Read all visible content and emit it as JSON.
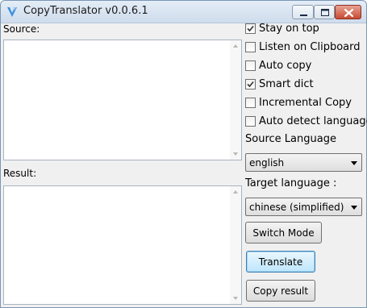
{
  "window": {
    "title": "CopyTranslator v0.0.6.1"
  },
  "titlebar_buttons": {
    "minimize_icon": "minimize-icon",
    "maximize_icon": "maximize-icon",
    "close_icon": "close-icon"
  },
  "source": {
    "label": "Source:",
    "value": ""
  },
  "result": {
    "label": "Result:",
    "value": ""
  },
  "options": [
    {
      "label": "Stay on top",
      "checked": true
    },
    {
      "label": "Listen on Clipboard",
      "checked": false
    },
    {
      "label": "Auto copy",
      "checked": false
    },
    {
      "label": "Smart dict",
      "checked": true
    },
    {
      "label": "Incremental Copy",
      "checked": false
    },
    {
      "label": "Auto detect language",
      "checked": false
    }
  ],
  "source_language": {
    "label": "Source Language",
    "selected": "english"
  },
  "target_language": {
    "label": "Target language :",
    "selected": "chinese (simplified)"
  },
  "buttons": {
    "switch_mode": "Switch Mode",
    "translate": "Translate",
    "copy_result": "Copy result"
  },
  "colors": {
    "accent": "#3c7fb1",
    "window_bg": "#f0f0f0",
    "close_button": "#c84a33"
  }
}
